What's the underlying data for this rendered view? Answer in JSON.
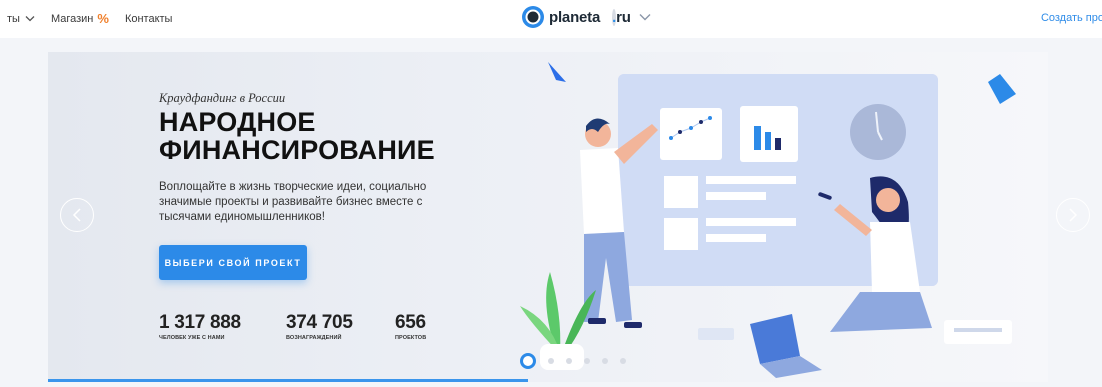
{
  "nav": {
    "items": [
      {
        "label": "ты"
      },
      {
        "label": "Магазин"
      },
      {
        "label": "Контакты"
      }
    ],
    "logo_brand": "planeta",
    "logo_dot": ".",
    "logo_tld": "ru",
    "create_label": "Создать про"
  },
  "hero": {
    "subtitle": "Краудфандинг в России",
    "title_line1": "НАРОДНОЕ",
    "title_line2": "ФИНАНСИРОВАНИЕ",
    "description": "Воплощайте в жизнь творческие идеи, социально значимые проекты и развивайте бизнес вместе с тысячами единомышленников!",
    "cta_label": "ВЫБЕРИ СВОЙ ПРОЕКТ",
    "stats": [
      {
        "value": "1 317 888",
        "label": "ЧЕЛОВЕК УЖЕ С НАМИ"
      },
      {
        "value": "374 705",
        "label": "ВОЗНАГРАЖДЕНИЙ"
      },
      {
        "value": "656",
        "label": "ПРОЕКТОВ"
      }
    ]
  },
  "carousel": {
    "slide_count": 6,
    "active_index": 0,
    "progress": 0.5
  },
  "colors": {
    "accent": "#2c8ae8",
    "shop_icon": "#f0802c",
    "text_dark": "#111111"
  },
  "icons": [
    "chevron-down-icon",
    "percent-icon",
    "planeta-logo-icon",
    "arrow-left-icon",
    "arrow-right-icon"
  ]
}
